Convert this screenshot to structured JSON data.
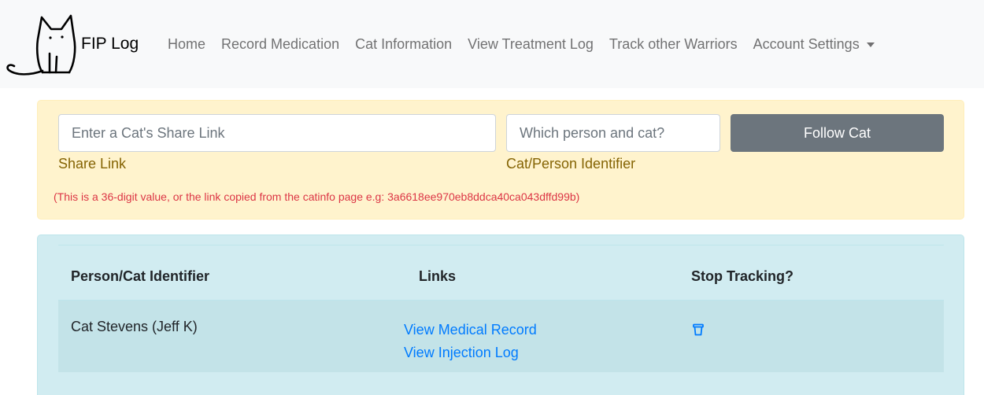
{
  "navbar": {
    "brand": "FIP Log",
    "links": [
      "Home",
      "Record Medication",
      "Cat Information",
      "View Treatment Log",
      "Track other Warriors"
    ],
    "dropdown": "Account Settings"
  },
  "follow": {
    "share_placeholder": "Enter a Cat's Share Link",
    "share_label": "Share Link",
    "person_placeholder": "Which person and cat?",
    "person_label": "Cat/Person Identifier",
    "button": "Follow Cat",
    "hint": "(This is a 36-digit value, or the link copied from the catinfo page e.g: 3a6618ee970eb8ddca40ca043dffd99b)"
  },
  "tracking": {
    "headers": [
      "Person/Cat Identifier",
      "Links",
      "Stop Tracking?"
    ],
    "rows": [
      {
        "identifier": "Cat Stevens (Jeff K)",
        "links": [
          "View Medical Record",
          "View Injection Log"
        ]
      }
    ]
  },
  "colors": {
    "warning_bg": "#fff3cd",
    "info_bg": "#d1ecf1",
    "link": "#007bff",
    "danger": "#dc3545",
    "button_bg": "#6c757d"
  },
  "icons": {
    "brand": "cat-logo-icon",
    "dropdown": "caret-down-icon",
    "delete": "trash-icon"
  }
}
